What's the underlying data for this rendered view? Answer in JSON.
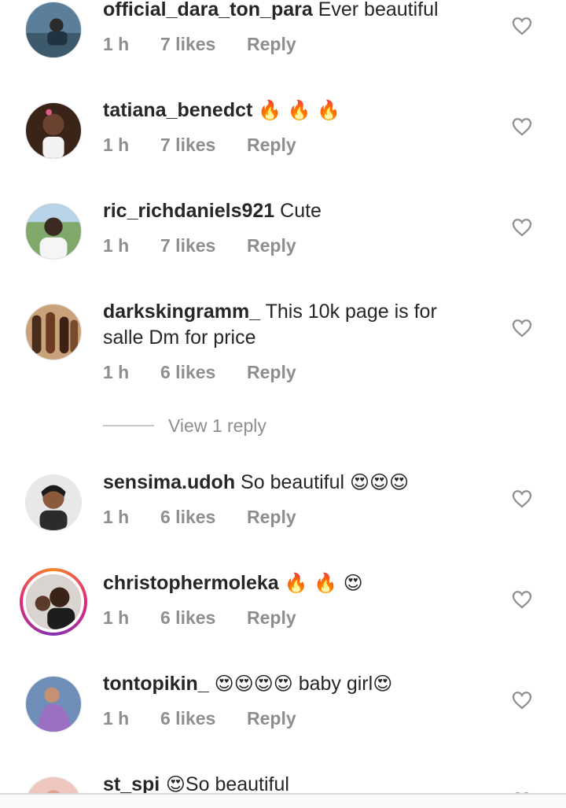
{
  "comments": [
    {
      "username": "official_dara_ton_para",
      "text": " Ever beautiful",
      "emoji": "",
      "time": "1 h",
      "likes": "7 likes",
      "reply": "Reply"
    },
    {
      "username": "tatiana_benedct",
      "text": " ",
      "emoji": "🔥 🔥 🔥",
      "time": "1 h",
      "likes": "7 likes",
      "reply": "Reply"
    },
    {
      "username": "ric_richdaniels921",
      "text": " Cute",
      "emoji": "",
      "time": "1 h",
      "likes": "7 likes",
      "reply": "Reply"
    },
    {
      "username": "darkskingramm_",
      "text": " This 10k page is for salle Dm for price",
      "emoji": "",
      "time": "1 h",
      "likes": "6 likes",
      "reply": "Reply"
    },
    {
      "username": "sensima.udoh",
      "text": " So beautiful ",
      "emoji": "😍😍😍",
      "time": "1 h",
      "likes": "6 likes",
      "reply": "Reply"
    },
    {
      "username": "christophermoleka",
      "text": " ",
      "emoji": "🔥 🔥 😍",
      "time": "1 h",
      "likes": "6 likes",
      "reply": "Reply"
    },
    {
      "username": "tontopikin_",
      "text": " ",
      "emoji": "😍😍😍😍",
      "text2": " baby girl",
      "emoji2": "😍",
      "time": "1 h",
      "likes": "6 likes",
      "reply": "Reply"
    },
    {
      "username": "st_spi",
      "text": "",
      "emoji": " 😍",
      "text2": "So beautiful",
      "time": "",
      "likes": "",
      "reply": ""
    }
  ],
  "view_replies": "View 1 reply",
  "icons": {
    "like": "heart-outline-icon"
  },
  "colors": {
    "text": "#262626",
    "meta": "#8e8e8e",
    "story_ring": "#dd2a7b"
  }
}
